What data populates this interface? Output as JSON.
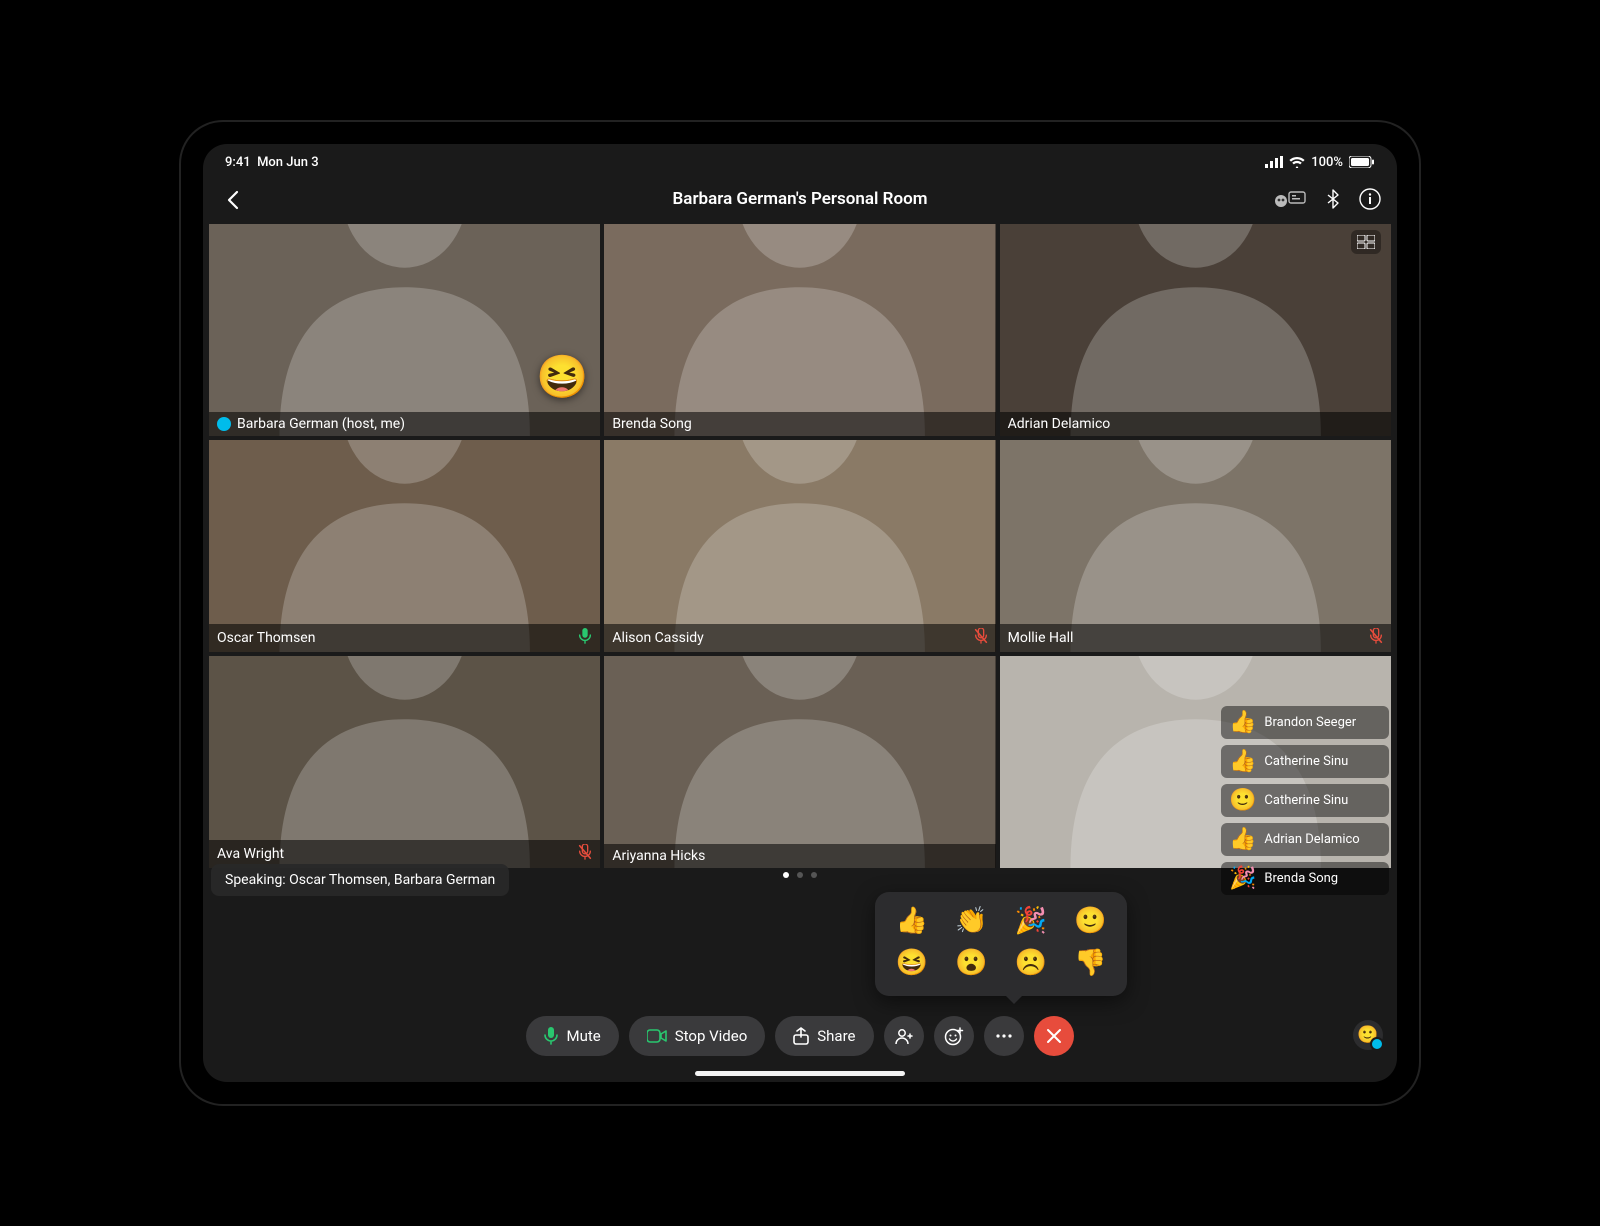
{
  "statusbar": {
    "time": "9:41",
    "date": "Mon Jun 3",
    "battery": "100%"
  },
  "header": {
    "title": "Barbara German's Personal Room"
  },
  "participants": [
    {
      "name": "Barbara German (host, me)",
      "host": true,
      "muted": false,
      "speaking": false,
      "reaction": "😆",
      "bg": "#6b6258"
    },
    {
      "name": "Brenda Song",
      "host": false,
      "muted": false,
      "speaking": false,
      "reaction": "",
      "bg": "#7a6b5e"
    },
    {
      "name": "Adrian Delamico",
      "host": false,
      "muted": false,
      "speaking": false,
      "reaction": "",
      "bg": "#4a4038"
    },
    {
      "name": "Oscar Thomsen",
      "host": false,
      "muted": false,
      "speaking": true,
      "reaction": "",
      "bg": "#6e5d4c"
    },
    {
      "name": "Alison Cassidy",
      "host": false,
      "muted": true,
      "speaking": false,
      "reaction": "",
      "bg": "#8a7a66"
    },
    {
      "name": "Mollie Hall",
      "host": false,
      "muted": true,
      "speaking": false,
      "reaction": "",
      "bg": "#7d7468"
    },
    {
      "name": "Ava Wright",
      "host": false,
      "muted": true,
      "speaking": false,
      "reaction": "",
      "bg": "#5c5347"
    },
    {
      "name": "Ariyanna Hicks",
      "host": false,
      "muted": false,
      "speaking": false,
      "reaction": "",
      "bg": "#6a6055"
    },
    {
      "name": "",
      "host": false,
      "muted": false,
      "speaking": false,
      "reaction": "",
      "bg": "#b8b4ad"
    }
  ],
  "speaking_banner": "Speaking: Oscar Thomsen, Barbara German",
  "controls": {
    "mute_label": "Mute",
    "video_label": "Stop Video",
    "share_label": "Share"
  },
  "reactions_popover": [
    "👍",
    "👏",
    "🎉",
    "🙂",
    "😆",
    "😮",
    "☹️",
    "👎"
  ],
  "reaction_feed": [
    {
      "emoji": "👍",
      "name": "Brandon Seeger"
    },
    {
      "emoji": "👍",
      "name": "Catherine Sinu"
    },
    {
      "emoji": "🙂",
      "name": "Catherine Sinu"
    },
    {
      "emoji": "👍",
      "name": "Adrian Delamico"
    },
    {
      "emoji": "🎉",
      "name": "Brenda Song"
    }
  ],
  "pages": {
    "count": 3,
    "active": 0
  }
}
